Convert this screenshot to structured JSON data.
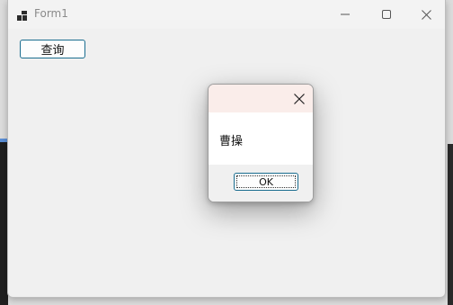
{
  "window": {
    "title": "Form1"
  },
  "main": {
    "query_label": "查询"
  },
  "dialog": {
    "message": "曹操",
    "ok_label": "OK"
  },
  "colors": {
    "dialog_titlebar": "#faedea",
    "button_border": "#1a6d8f"
  },
  "icons": {
    "app": "app-icon",
    "minimize": "minimize-icon",
    "maximize": "maximize-icon",
    "close": "close-icon",
    "dialog_close": "close-icon"
  }
}
